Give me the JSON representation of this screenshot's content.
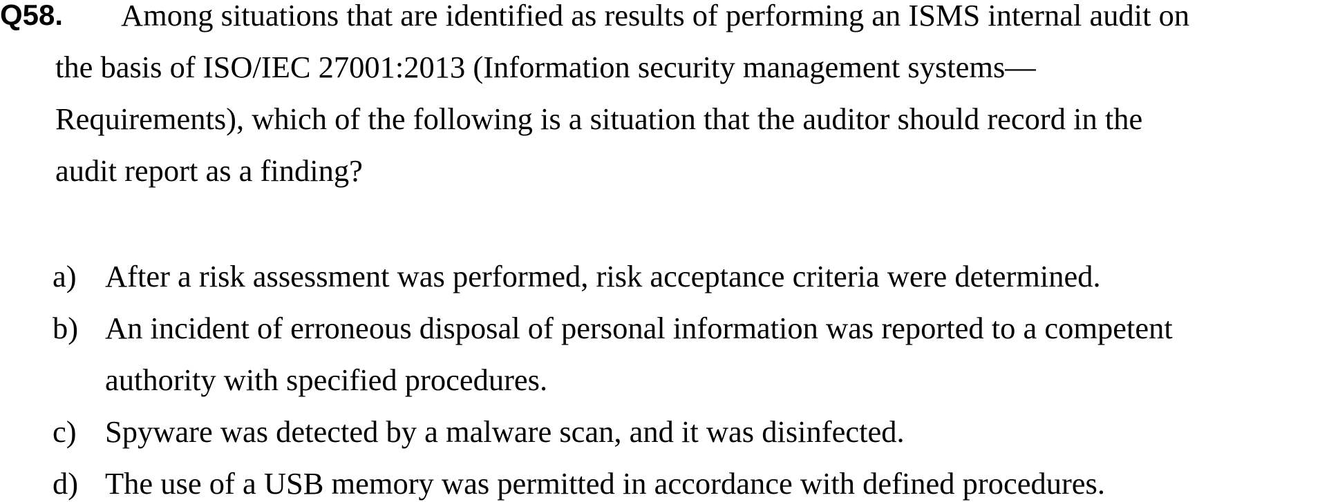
{
  "question": {
    "number": "Q58.",
    "lines": [
      "Among situations that are identified as results of performing an ISMS internal audit on",
      "the basis of ISO/IEC 27001:2013 (Information security management systems—",
      "Requirements), which of the following is a situation that the auditor should record in the",
      "audit report as a finding?"
    ]
  },
  "choices": [
    {
      "letter": "a)",
      "lines": [
        "After a risk assessment was performed, risk acceptance criteria were determined."
      ]
    },
    {
      "letter": "b)",
      "lines": [
        "An incident of erroneous disposal of personal information was reported to a competent",
        "authority with specified procedures."
      ]
    },
    {
      "letter": "c)",
      "lines": [
        "Spyware was detected by a malware scan, and it was disinfected."
      ]
    },
    {
      "letter": "d)",
      "lines": [
        "The use of a USB memory was permitted in accordance with defined procedures."
      ]
    }
  ]
}
